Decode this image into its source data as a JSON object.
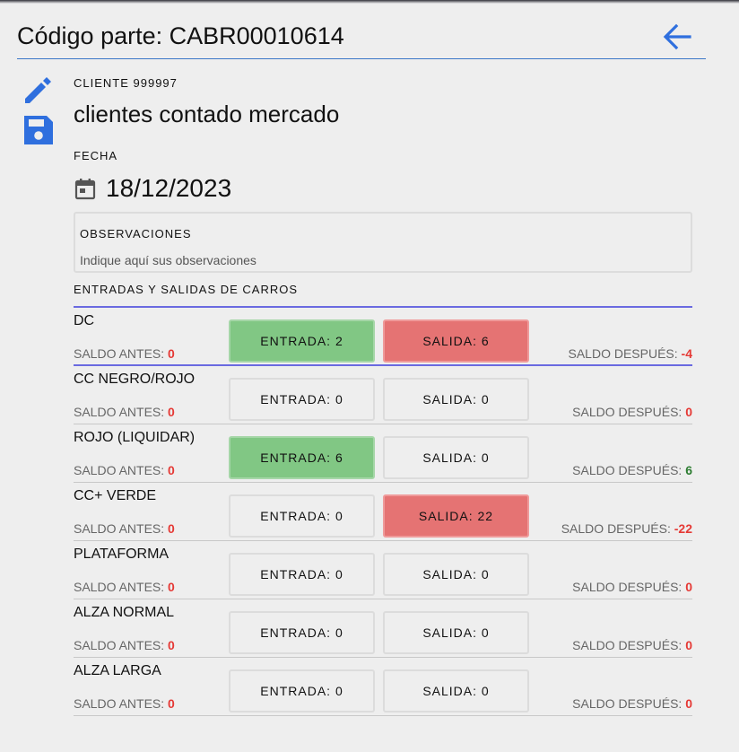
{
  "header": {
    "title": "Código parte: CABR00010614"
  },
  "cliente": {
    "label": "CLIENTE 999997",
    "name": "clientes contado mercado"
  },
  "fecha": {
    "label": "FECHA",
    "value": "18/12/2023"
  },
  "observaciones": {
    "label": "OBSERVACIONES",
    "placeholder": "Indique aquí sus observaciones"
  },
  "section_title": "ENTRADAS Y SALIDAS DE CARROS",
  "saldo_antes_label": "SALDO ANTES: ",
  "saldo_despues_label": "SALDO DESPUÉS: ",
  "rows": [
    {
      "name": "DC",
      "saldo_antes": "0",
      "entrada": "ENTRADA: 2",
      "salida": "SALIDA: 6",
      "saldo_despues": "-4"
    },
    {
      "name": "CC NEGRO/ROJO",
      "saldo_antes": "0",
      "entrada": "ENTRADA: 0",
      "salida": "SALIDA: 0",
      "saldo_despues": "0"
    },
    {
      "name": "ROJO (LIQUIDAR)",
      "saldo_antes": "0",
      "entrada": "ENTRADA: 6",
      "salida": "SALIDA: 0",
      "saldo_despues": "6"
    },
    {
      "name": "CC+ VERDE",
      "saldo_antes": "0",
      "entrada": "ENTRADA: 0",
      "salida": "SALIDA: 22",
      "saldo_despues": "-22"
    },
    {
      "name": "PLATAFORMA",
      "saldo_antes": "0",
      "entrada": "ENTRADA: 0",
      "salida": "SALIDA: 0",
      "saldo_despues": "0"
    },
    {
      "name": "ALZA NORMAL",
      "saldo_antes": "0",
      "entrada": "ENTRADA: 0",
      "salida": "SALIDA: 0",
      "saldo_despues": "0"
    },
    {
      "name": "ALZA LARGA",
      "saldo_antes": "0",
      "entrada": "ENTRADA: 0",
      "salida": "SALIDA: 0",
      "saldo_despues": "0"
    }
  ],
  "colors": {
    "accent": "#3b77c8",
    "icon": "#2f6fde",
    "entrada_active": "#81c784",
    "salida_active": "#e57373",
    "negative": "#e53935",
    "positive": "#2e7d32",
    "divider": "#6a6ae0"
  },
  "icons": {
    "back": "arrow-back-icon",
    "edit": "pencil-icon",
    "save": "floppy-disk-icon",
    "calendar": "calendar-icon"
  }
}
